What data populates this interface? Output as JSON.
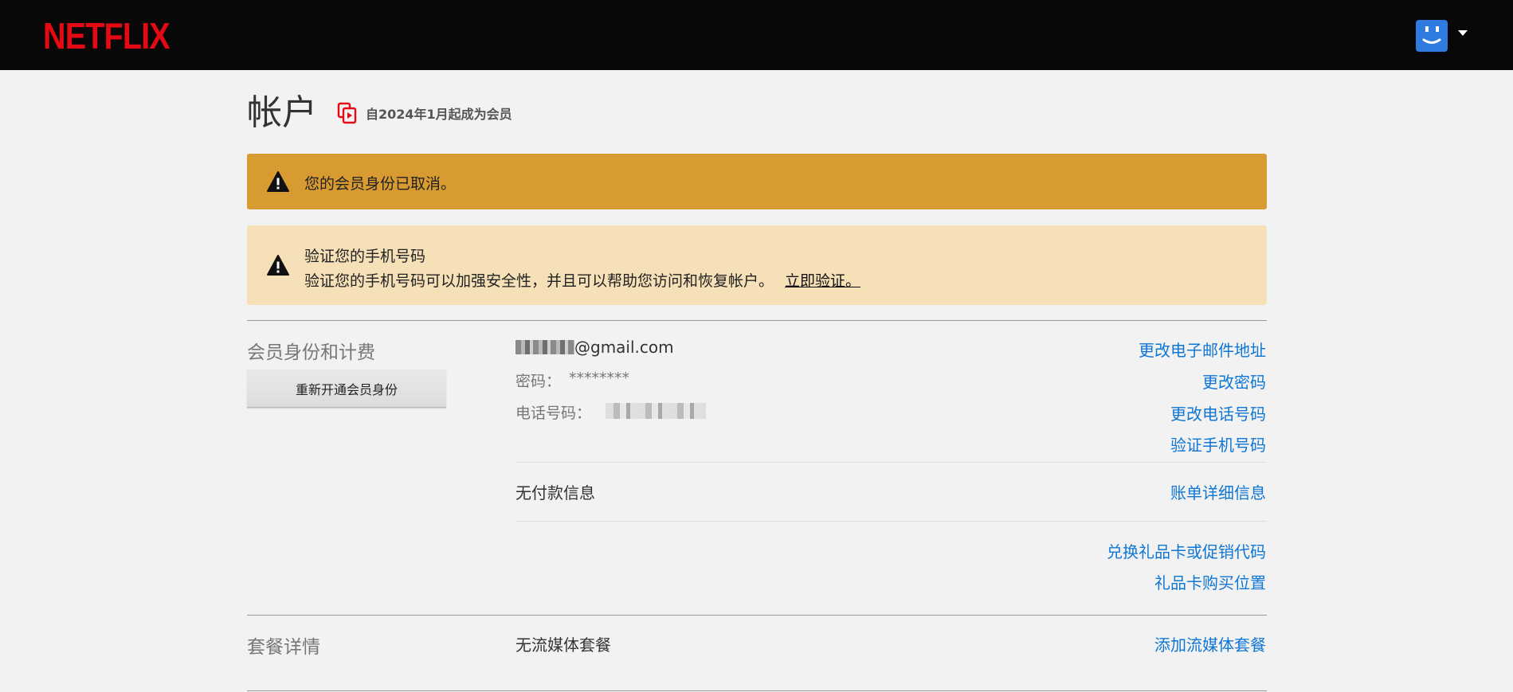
{
  "header": {
    "logo": "NETFLIX",
    "profile_icon": "smiley-face-icon",
    "menu_icon": "caret-down-icon"
  },
  "page": {
    "title": "帐户",
    "member_since": "自2024年1月起成为会员",
    "member_icon": "membership-card-icon"
  },
  "alerts": {
    "cancelled": "您的会员身份已取消。",
    "verify_title": "验证您的手机号码",
    "verify_body": "验证您的手机号码可以加强安全性，并且可以帮助您访问和恢复帐户。",
    "verify_link": "立即验证。",
    "icon": "warning-triangle-icon"
  },
  "membership": {
    "section_title": "会员身份和计费",
    "reopen_button": "重新开通会员身份",
    "email": "@gmail.com",
    "password_label": "密码：",
    "password_value": "********",
    "phone_label": "电话号码：",
    "payment_text": "无付款信息",
    "links": {
      "change_email": "更改电子邮件地址",
      "change_password": "更改密码",
      "change_phone": "更改电话号码",
      "verify_phone": "验证手机号码",
      "billing_details": "账单详细信息",
      "redeem_gift": "兑换礼品卡或促销代码",
      "gift_card_locations": "礼品卡购买位置"
    }
  },
  "plan": {
    "section_title": "套餐详情",
    "value": "无流媒体套餐",
    "add_plan_link": "添加流媒体套餐"
  },
  "colors": {
    "brand_red": "#e50914",
    "alert_dark": "#d89b31",
    "alert_light": "#f6e0b8",
    "link_blue": "#0f76d4",
    "header_bg": "#080808"
  }
}
